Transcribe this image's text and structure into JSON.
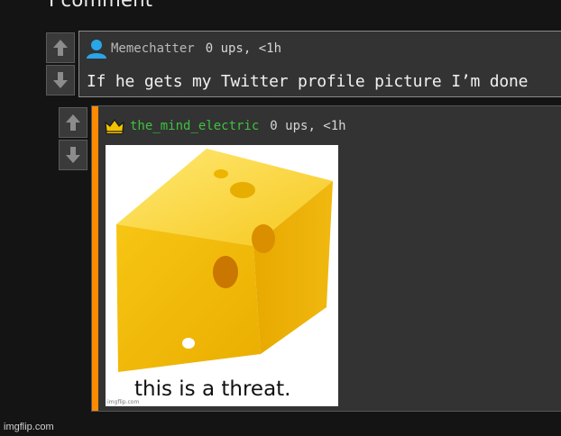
{
  "header": {
    "title": "I comment"
  },
  "comments": [
    {
      "author": "Memechatter",
      "meta": "0 ups, <1h",
      "text": "If he gets my Twitter profile picture I’m done",
      "avatar_icon": "user-icon"
    },
    {
      "author": "the_mind_electric",
      "meta": "0 ups, <1h",
      "avatar_icon": "crown-icon",
      "accent_color": "#ff8a00",
      "author_color": "#3fc13f",
      "image": {
        "caption": "this is a threat.",
        "watermark": "imgflip.com",
        "depicts": "cheese-wedge"
      }
    }
  ],
  "vote_icons": {
    "up": "arrow-up-icon",
    "down": "arrow-down-icon"
  },
  "footer": {
    "watermark": "imgflip.com"
  }
}
